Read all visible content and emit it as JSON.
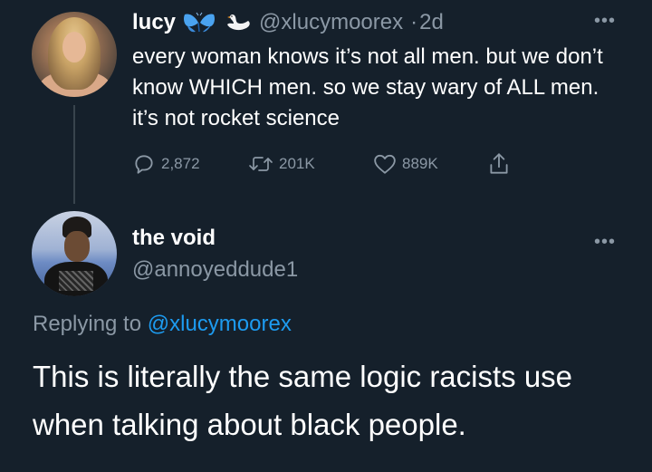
{
  "tweet1": {
    "display_name": "lucy",
    "emojis": [
      "butterfly-emoji",
      "swan-emoji"
    ],
    "handle": "@xlucymoorex",
    "separator": "·",
    "time": "2d",
    "text": "every woman knows it’s not all men. but we don’t know WHICH men. so we stay wary of ALL men. it’s not rocket science",
    "stats": {
      "replies": "2,872",
      "retweets": "201K",
      "likes": "889K"
    },
    "icons": {
      "reply": "reply-icon",
      "retweet": "retweet-icon",
      "like": "heart-icon",
      "share": "share-icon",
      "more": "more-icon"
    }
  },
  "tweet2": {
    "display_name": "the void",
    "handle": "@annoyeddude1",
    "replying_prefix": "Replying to",
    "replying_to": "@xlucymoorex",
    "text": "This is literally the same logic racists use when talking about black people.",
    "more_icon": "more-icon"
  },
  "colors": {
    "background": "#15202b",
    "text_primary": "#ffffff",
    "text_secondary": "#8b98a5",
    "accent": "#1d9bf0",
    "divider": "#38444d"
  }
}
